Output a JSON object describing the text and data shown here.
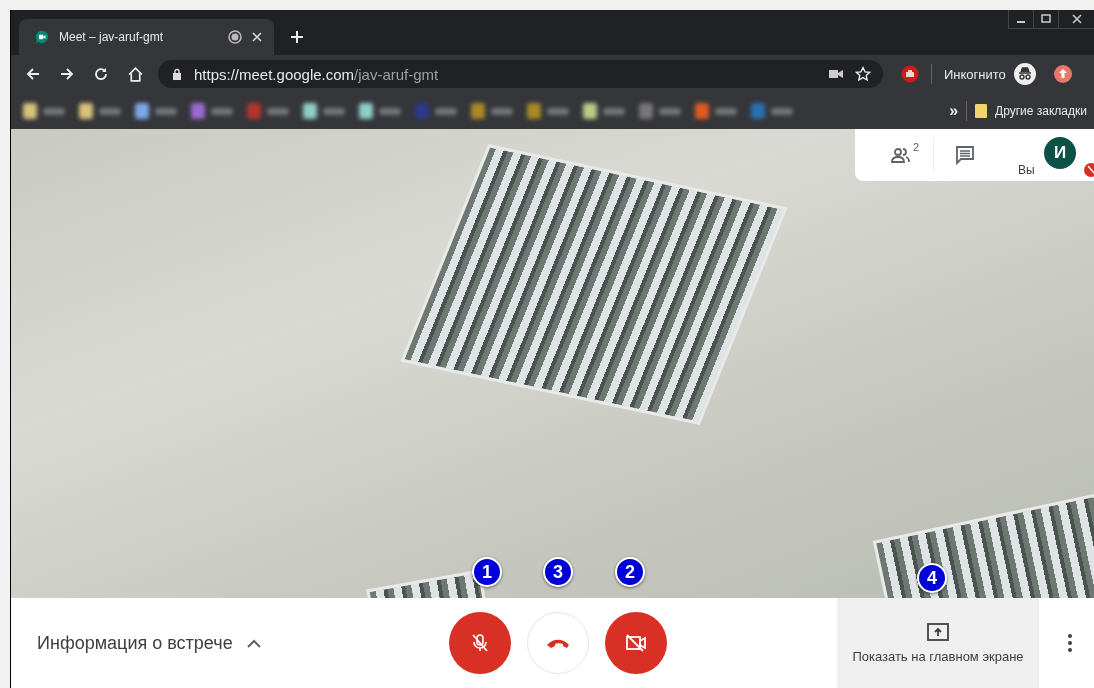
{
  "tab": {
    "title": "Meet – jav-aruf-gmt"
  },
  "address": {
    "host": "https://meet.google.com",
    "path": "/jav-aruf-gmt"
  },
  "profile": {
    "label": "Инкогнито"
  },
  "bookmarks": {
    "overflow": "»",
    "other": "Другие закладки"
  },
  "side_panel": {
    "participants_count": "2",
    "self_label": "Вы",
    "avatar_letter": "И",
    "self_muted": true
  },
  "markers": [
    "1",
    "3",
    "2",
    "4"
  ],
  "bottom_bar": {
    "meeting_info": "Информация о встрече",
    "mic_on": false,
    "camera_on": false,
    "present_label": "Показать на главном экране"
  }
}
